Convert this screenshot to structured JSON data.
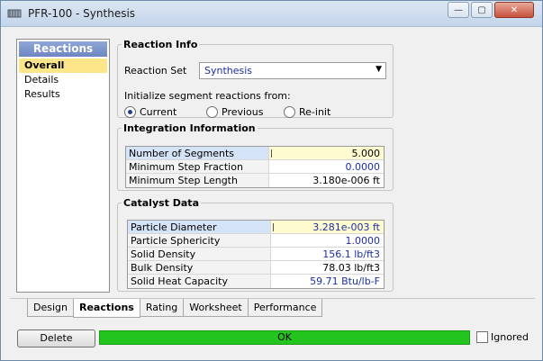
{
  "window": {
    "title": "PFR-100 - Synthesis",
    "minimize_glyph": "—",
    "maximize_glyph": "▢",
    "close_glyph": "✕"
  },
  "sidebar": {
    "header": "Reactions",
    "items": [
      {
        "label": "Overall",
        "selected": true
      },
      {
        "label": "Details",
        "selected": false
      },
      {
        "label": "Results",
        "selected": false
      }
    ]
  },
  "reaction_info": {
    "legend": "Reaction Info",
    "reaction_set_label": "Reaction Set",
    "reaction_set_value": "Synthesis",
    "dropdown_glyph": "▼",
    "init_label": "Initialize segment reactions from:",
    "radio_current": "Current",
    "radio_previous": "Previous",
    "radio_reinit": "Re-init",
    "selected_radio": "Current"
  },
  "integration": {
    "legend": "Integration Information",
    "rows": [
      {
        "label": "Number of Segments",
        "value": "5.000"
      },
      {
        "label": "Minimum Step Fraction",
        "value": "0.0000"
      },
      {
        "label": "Minimum Step Length",
        "value": "3.180e-006 ft"
      }
    ]
  },
  "catalyst": {
    "legend": "Catalyst Data",
    "rows": [
      {
        "label": "Particle Diameter",
        "value": "3.281e-003 ft"
      },
      {
        "label": "Particle Sphericity",
        "value": "1.0000"
      },
      {
        "label": "Solid Density",
        "value": "156.1 lb/ft3"
      },
      {
        "label": "Bulk Density",
        "value": "78.03 lb/ft3"
      },
      {
        "label": "Solid Heat Capacity",
        "value": "59.71 Btu/lb-F"
      }
    ]
  },
  "tabs": [
    {
      "label": "Design",
      "active": false
    },
    {
      "label": "Reactions",
      "active": true
    },
    {
      "label": "Rating",
      "active": false
    },
    {
      "label": "Worksheet",
      "active": false
    },
    {
      "label": "Performance",
      "active": false
    }
  ],
  "footer": {
    "delete_label": "Delete",
    "status_text": "OK",
    "status_color": "#22c41d",
    "ignored_label": "Ignored",
    "ignored_checked": false
  }
}
